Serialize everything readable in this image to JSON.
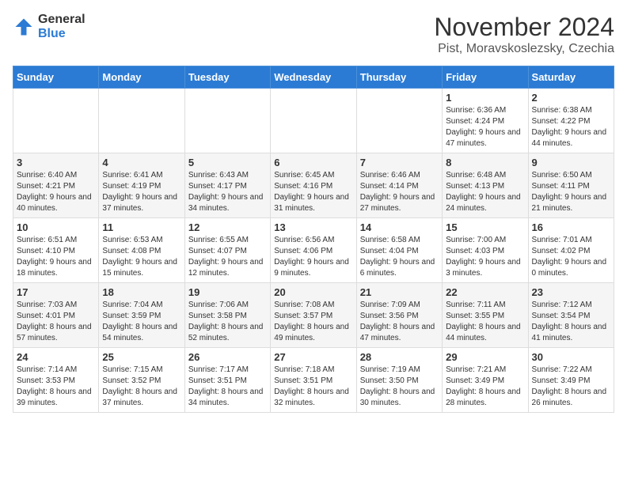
{
  "header": {
    "logo_general": "General",
    "logo_blue": "Blue",
    "month_title": "November 2024",
    "location": "Pist, Moravskoslezsky, Czechia"
  },
  "days_of_week": [
    "Sunday",
    "Monday",
    "Tuesday",
    "Wednesday",
    "Thursday",
    "Friday",
    "Saturday"
  ],
  "weeks": [
    [
      {
        "day": "",
        "info": ""
      },
      {
        "day": "",
        "info": ""
      },
      {
        "day": "",
        "info": ""
      },
      {
        "day": "",
        "info": ""
      },
      {
        "day": "",
        "info": ""
      },
      {
        "day": "1",
        "info": "Sunrise: 6:36 AM\nSunset: 4:24 PM\nDaylight: 9 hours and 47 minutes."
      },
      {
        "day": "2",
        "info": "Sunrise: 6:38 AM\nSunset: 4:22 PM\nDaylight: 9 hours and 44 minutes."
      }
    ],
    [
      {
        "day": "3",
        "info": "Sunrise: 6:40 AM\nSunset: 4:21 PM\nDaylight: 9 hours and 40 minutes."
      },
      {
        "day": "4",
        "info": "Sunrise: 6:41 AM\nSunset: 4:19 PM\nDaylight: 9 hours and 37 minutes."
      },
      {
        "day": "5",
        "info": "Sunrise: 6:43 AM\nSunset: 4:17 PM\nDaylight: 9 hours and 34 minutes."
      },
      {
        "day": "6",
        "info": "Sunrise: 6:45 AM\nSunset: 4:16 PM\nDaylight: 9 hours and 31 minutes."
      },
      {
        "day": "7",
        "info": "Sunrise: 6:46 AM\nSunset: 4:14 PM\nDaylight: 9 hours and 27 minutes."
      },
      {
        "day": "8",
        "info": "Sunrise: 6:48 AM\nSunset: 4:13 PM\nDaylight: 9 hours and 24 minutes."
      },
      {
        "day": "9",
        "info": "Sunrise: 6:50 AM\nSunset: 4:11 PM\nDaylight: 9 hours and 21 minutes."
      }
    ],
    [
      {
        "day": "10",
        "info": "Sunrise: 6:51 AM\nSunset: 4:10 PM\nDaylight: 9 hours and 18 minutes."
      },
      {
        "day": "11",
        "info": "Sunrise: 6:53 AM\nSunset: 4:08 PM\nDaylight: 9 hours and 15 minutes."
      },
      {
        "day": "12",
        "info": "Sunrise: 6:55 AM\nSunset: 4:07 PM\nDaylight: 9 hours and 12 minutes."
      },
      {
        "day": "13",
        "info": "Sunrise: 6:56 AM\nSunset: 4:06 PM\nDaylight: 9 hours and 9 minutes."
      },
      {
        "day": "14",
        "info": "Sunrise: 6:58 AM\nSunset: 4:04 PM\nDaylight: 9 hours and 6 minutes."
      },
      {
        "day": "15",
        "info": "Sunrise: 7:00 AM\nSunset: 4:03 PM\nDaylight: 9 hours and 3 minutes."
      },
      {
        "day": "16",
        "info": "Sunrise: 7:01 AM\nSunset: 4:02 PM\nDaylight: 9 hours and 0 minutes."
      }
    ],
    [
      {
        "day": "17",
        "info": "Sunrise: 7:03 AM\nSunset: 4:01 PM\nDaylight: 8 hours and 57 minutes."
      },
      {
        "day": "18",
        "info": "Sunrise: 7:04 AM\nSunset: 3:59 PM\nDaylight: 8 hours and 54 minutes."
      },
      {
        "day": "19",
        "info": "Sunrise: 7:06 AM\nSunset: 3:58 PM\nDaylight: 8 hours and 52 minutes."
      },
      {
        "day": "20",
        "info": "Sunrise: 7:08 AM\nSunset: 3:57 PM\nDaylight: 8 hours and 49 minutes."
      },
      {
        "day": "21",
        "info": "Sunrise: 7:09 AM\nSunset: 3:56 PM\nDaylight: 8 hours and 47 minutes."
      },
      {
        "day": "22",
        "info": "Sunrise: 7:11 AM\nSunset: 3:55 PM\nDaylight: 8 hours and 44 minutes."
      },
      {
        "day": "23",
        "info": "Sunrise: 7:12 AM\nSunset: 3:54 PM\nDaylight: 8 hours and 41 minutes."
      }
    ],
    [
      {
        "day": "24",
        "info": "Sunrise: 7:14 AM\nSunset: 3:53 PM\nDaylight: 8 hours and 39 minutes."
      },
      {
        "day": "25",
        "info": "Sunrise: 7:15 AM\nSunset: 3:52 PM\nDaylight: 8 hours and 37 minutes."
      },
      {
        "day": "26",
        "info": "Sunrise: 7:17 AM\nSunset: 3:51 PM\nDaylight: 8 hours and 34 minutes."
      },
      {
        "day": "27",
        "info": "Sunrise: 7:18 AM\nSunset: 3:51 PM\nDaylight: 8 hours and 32 minutes."
      },
      {
        "day": "28",
        "info": "Sunrise: 7:19 AM\nSunset: 3:50 PM\nDaylight: 8 hours and 30 minutes."
      },
      {
        "day": "29",
        "info": "Sunrise: 7:21 AM\nSunset: 3:49 PM\nDaylight: 8 hours and 28 minutes."
      },
      {
        "day": "30",
        "info": "Sunrise: 7:22 AM\nSunset: 3:49 PM\nDaylight: 8 hours and 26 minutes."
      }
    ]
  ]
}
